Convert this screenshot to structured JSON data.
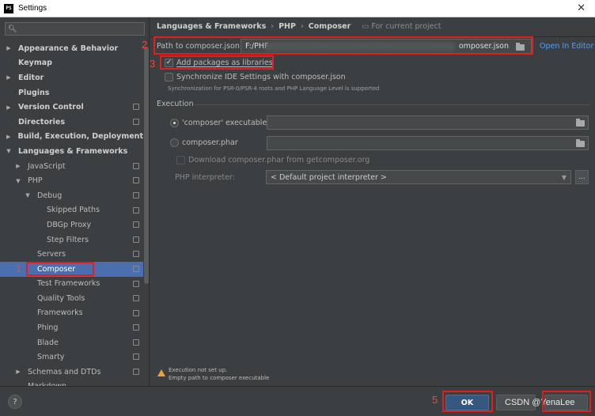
{
  "window": {
    "title": "Settings",
    "app_icon": "PS"
  },
  "search": {
    "placeholder": ""
  },
  "tree": [
    {
      "label": "Appearance & Behavior",
      "level": 0,
      "arrow": "▶",
      "bold": true,
      "proj": false
    },
    {
      "label": "Keymap",
      "level": 0,
      "arrow": "",
      "bold": true,
      "proj": false
    },
    {
      "label": "Editor",
      "level": 0,
      "arrow": "▶",
      "bold": true,
      "proj": false
    },
    {
      "label": "Plugins",
      "level": 0,
      "arrow": "",
      "bold": true,
      "proj": false
    },
    {
      "label": "Version Control",
      "level": 0,
      "arrow": "▶",
      "bold": true,
      "proj": true
    },
    {
      "label": "Directories",
      "level": 0,
      "arrow": "",
      "bold": true,
      "proj": true
    },
    {
      "label": "Build, Execution, Deployment",
      "level": 0,
      "arrow": "▶",
      "bold": true,
      "proj": false
    },
    {
      "label": "Languages & Frameworks",
      "level": 0,
      "arrow": "▼",
      "bold": true,
      "proj": false
    },
    {
      "label": "JavaScript",
      "level": 1,
      "arrow": "▶",
      "bold": false,
      "proj": true
    },
    {
      "label": "PHP",
      "level": 1,
      "arrow": "▼",
      "bold": false,
      "proj": true
    },
    {
      "label": "Debug",
      "level": 2,
      "arrow": "▼",
      "bold": false,
      "proj": true
    },
    {
      "label": "Skipped Paths",
      "level": 3,
      "arrow": "",
      "bold": false,
      "proj": true
    },
    {
      "label": "DBGp Proxy",
      "level": 3,
      "arrow": "",
      "bold": false,
      "proj": true
    },
    {
      "label": "Step Filters",
      "level": 3,
      "arrow": "",
      "bold": false,
      "proj": true
    },
    {
      "label": "Servers",
      "level": 2,
      "arrow": "",
      "bold": false,
      "proj": true
    },
    {
      "label": "Composer",
      "level": 2,
      "arrow": "",
      "bold": false,
      "proj": true,
      "selected": true
    },
    {
      "label": "Test Frameworks",
      "level": 2,
      "arrow": "",
      "bold": false,
      "proj": true
    },
    {
      "label": "Quality Tools",
      "level": 2,
      "arrow": "",
      "bold": false,
      "proj": true
    },
    {
      "label": "Frameworks",
      "level": 2,
      "arrow": "",
      "bold": false,
      "proj": true
    },
    {
      "label": "Phing",
      "level": 2,
      "arrow": "",
      "bold": false,
      "proj": true
    },
    {
      "label": "Blade",
      "level": 2,
      "arrow": "",
      "bold": false,
      "proj": true
    },
    {
      "label": "Smarty",
      "level": 2,
      "arrow": "",
      "bold": false,
      "proj": true
    },
    {
      "label": "Schemas and DTDs",
      "level": 1,
      "arrow": "▶",
      "bold": false,
      "proj": true
    },
    {
      "label": "Markdown",
      "level": 1,
      "arrow": "",
      "bold": false,
      "proj": false
    }
  ],
  "breadcrumb": {
    "part1": "Languages & Frameworks",
    "sep": "›",
    "part2": "PHP",
    "part3": "Composer",
    "scope": "For current project"
  },
  "path": {
    "label": "Path to composer.json:",
    "value_start": "F:/PHF",
    "value_end": "omposer.json",
    "open_link": "Open In Editor"
  },
  "options": {
    "add_packages": {
      "label": "Add packages as libraries",
      "checked": true
    },
    "sync": {
      "label": "Synchronize IDE Settings with composer.json",
      "checked": false,
      "hint": "Synchronization for PSR-0/PSR-4 roots and PHP Language Level is supported"
    }
  },
  "execution": {
    "title": "Execution",
    "executable_label": "'composer' executable",
    "phar_label": "composer.phar",
    "download_label": "Download composer.phar from getcomposer.org",
    "interpreter_label": "PHP interpreter:",
    "interpreter_value": "< Default project interpreter >",
    "more": "..."
  },
  "warning": {
    "line1": "Execution not set up.",
    "line2": "Empty path to composer executable"
  },
  "buttons": {
    "help": "?",
    "ok": "OK",
    "cancel": "",
    "apply": ""
  },
  "annotations": [
    "1",
    "2",
    "3",
    "5"
  ],
  "watermark": "CSDN @YenaLee",
  "colors": {
    "accent": "#4b6eaf",
    "annotation_red": "#e02020",
    "link": "#589df6"
  }
}
